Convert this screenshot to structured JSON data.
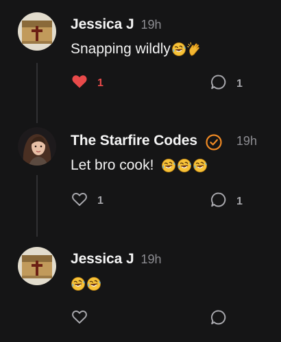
{
  "comments": [
    {
      "author": "Jessica J",
      "time": "19h",
      "text": "Snapping wildly",
      "emojis": [
        "rofl-emoji",
        "clapping-hands-emoji"
      ],
      "liked": true,
      "like_count": "1",
      "reply_count": "1"
    },
    {
      "author": "The Starfire Codes",
      "verified": true,
      "time": "19h",
      "text": "Let bro cook! ",
      "emojis": [
        "rofl-emoji",
        "rofl-emoji",
        "rofl-emoji"
      ],
      "liked": false,
      "like_count": "1",
      "reply_count": "1"
    },
    {
      "author": "Jessica J",
      "time": "19h",
      "text": "",
      "emojis": [
        "rofl-emoji",
        "rofl-emoji"
      ],
      "liked": false,
      "like_count": "",
      "reply_count": ""
    }
  ],
  "colors": {
    "background": "#151516",
    "like_active": "#e84a4a",
    "verified_badge": "#f08a24",
    "muted_text": "#8d8d92"
  },
  "icons": {
    "like": "heart-icon",
    "reply": "speech-bubble-icon",
    "verified": "verified-check-icon"
  }
}
